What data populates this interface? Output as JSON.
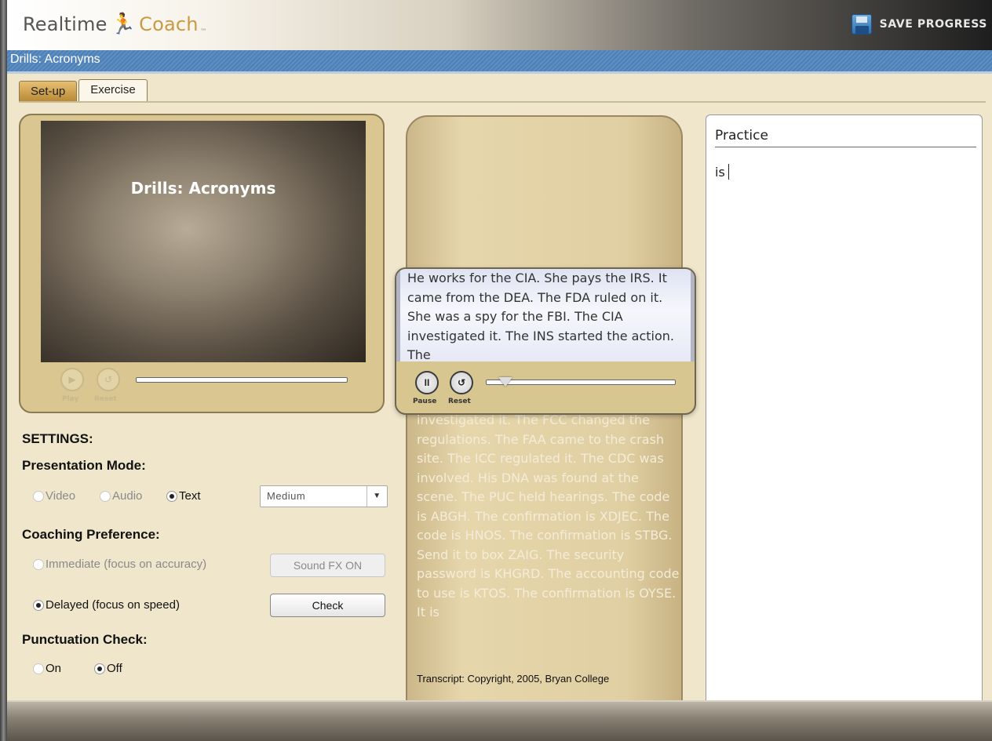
{
  "app": {
    "logo_part1": "Realtime",
    "logo_figure": "🏃",
    "logo_part2": "Coach",
    "logo_tm": "™",
    "save_label": "SAVE PROGRESS"
  },
  "titlebar": {
    "title": "Drills: Acronyms"
  },
  "tabs": [
    {
      "label": "Set-up"
    },
    {
      "label": "Exercise"
    }
  ],
  "video": {
    "title": "Drills: Acronyms",
    "play_label": "Play",
    "reset_label": "Reset"
  },
  "settings": {
    "heading": "SETTINGS:",
    "presentation_mode": {
      "heading": "Presentation Mode:",
      "options": [
        "Video",
        "Audio",
        "Text"
      ],
      "selected": "Text",
      "speed_select": "Medium"
    },
    "coaching_preference": {
      "heading": "Coaching Preference:",
      "immediate_label": "Immediate (focus on accuracy)",
      "delayed_label": "Delayed (focus on speed)",
      "selected": "Delayed (focus on speed)",
      "sound_fx_label": "Sound FX ON",
      "check_label": "Check"
    },
    "punctuation_check": {
      "heading": "Punctuation Check:",
      "on_label": "On",
      "off_label": "Off",
      "selected": "Off"
    }
  },
  "transcript": {
    "focus_text": "He works for the CIA. She pays the IRS. It came from the DEA. The FDA ruled on it. She was a spy for the FBI. The CIA investigated it. The INS started the action. The",
    "faded_text": "investigated it. The FCC changed the regulations. The FAA came to the crash site. The ICC regulated it. The CDC was involved. His DNA was found at the scene. The PUC held hearings. The code is ABGH. The confirmation is XDJEC. The code is HNOS. The confirmation is STBG. Send it to box ZAIG. The security password is KHGRD. The accounting code to use is KTOS. The confirmation is OYSE. It is",
    "copyright": "Transcript: Copyright,  2005, Bryan College",
    "pause_label": "Pause",
    "reset_label": "Reset"
  },
  "practice": {
    "title": "Practice",
    "typed_text": "is"
  }
}
